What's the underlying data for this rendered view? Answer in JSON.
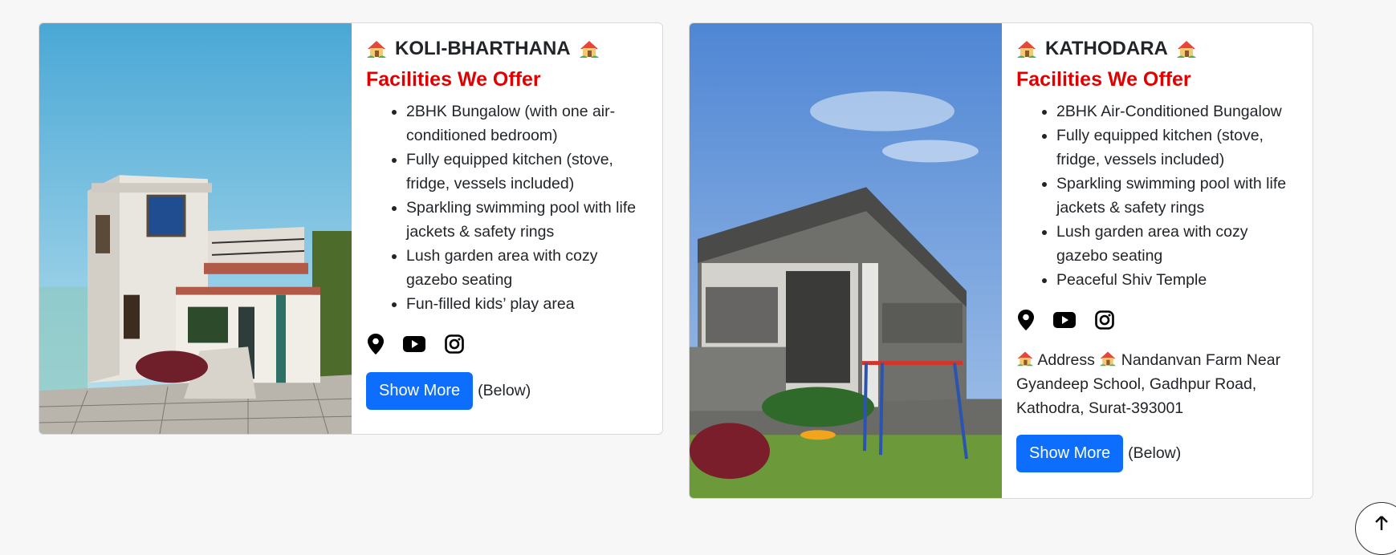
{
  "cards": [
    {
      "title": "KOLI-BHARTHANA",
      "facilities_heading": "Facilities We Offer",
      "features": [
        "2BHK Bungalow (with one air-conditioned bedroom)",
        "Fully equipped kitchen (stove, fridge, vessels included)",
        "Sparkling swimming pool with life jackets & safety rings",
        "Lush garden area with cozy gazebo seating",
        "Fun-filled kids’ play area"
      ],
      "social_icons": [
        "location-pin-icon",
        "youtube-icon",
        "instagram-icon"
      ],
      "button_label": "Show More",
      "button_note": "(Below)"
    },
    {
      "title": "KATHODARA",
      "facilities_heading": "Facilities We Offer",
      "features": [
        "2BHK Air-Conditioned Bungalow",
        "Fully equipped kitchen (stove, fridge, vessels included)",
        "Sparkling swimming pool with life jackets & safety rings",
        "Lush garden area with cozy gazebo seating",
        "Peaceful Shiv Temple"
      ],
      "social_icons": [
        "location-pin-icon",
        "youtube-icon",
        "instagram-icon"
      ],
      "address_label": "Address",
      "address_text": "Nandanvan Farm Near Gyandeep School, Gadhpur Road, Kathodra, Surat-393001",
      "button_label": "Show More",
      "button_note": "(Below)"
    }
  ],
  "colors": {
    "accent_red": "#e00000",
    "button_blue": "#0d6efd"
  }
}
